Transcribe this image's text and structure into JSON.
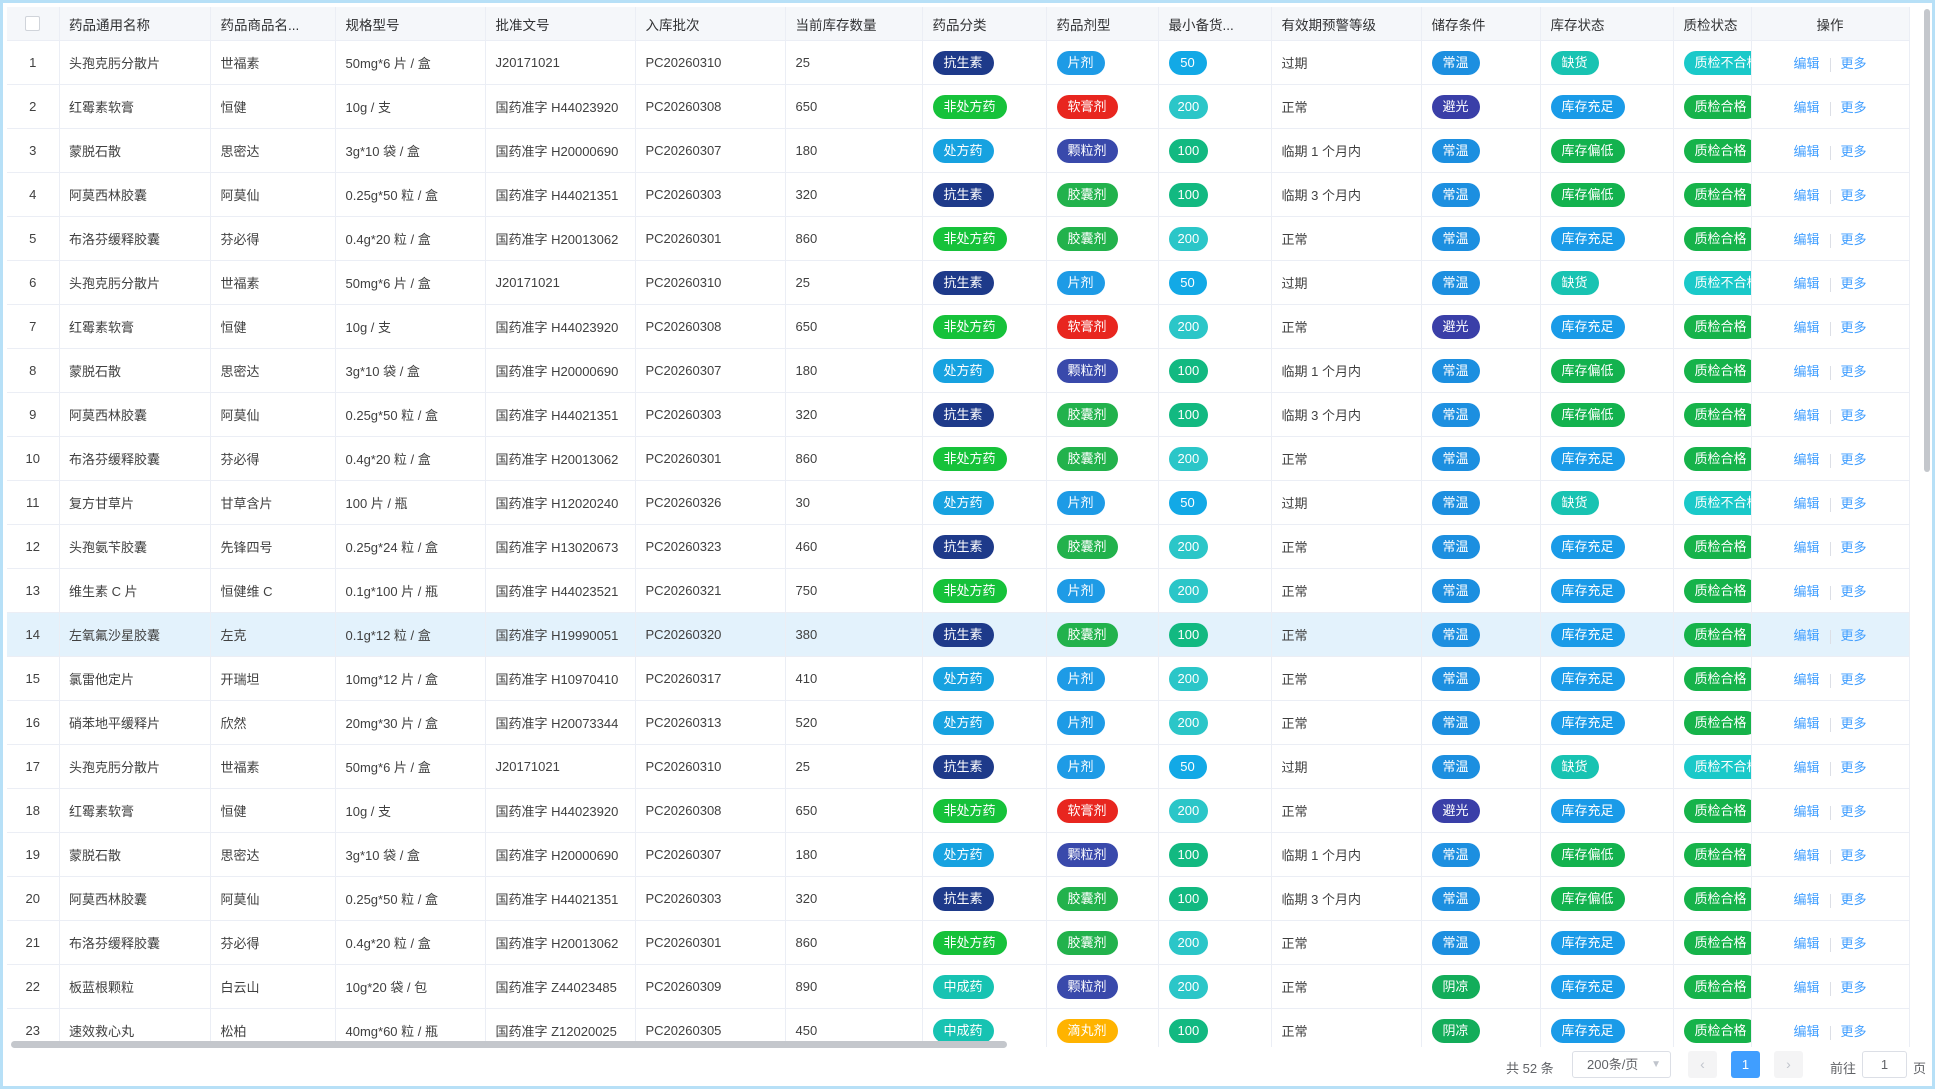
{
  "table": {
    "columns": [
      "",
      "",
      "药品通用名称",
      "药品商品名...",
      "规格型号",
      "批准文号",
      "入库批次",
      "当前库存数量",
      "药品分类",
      "药品剂型",
      "最小备货...",
      "有效期预警等级",
      "储存条件",
      "库存状态",
      "质检状态",
      "操作"
    ],
    "highlight_row": 14,
    "op_labels": {
      "edit": "编辑",
      "more": "更多"
    },
    "colors": {
      "抗生素": "#1e3a8a",
      "非处方药": "#16c23a",
      "处方药": "#17a2e0",
      "中成药": "#17c3b2",
      "片剂": "#1e9be6",
      "软膏剂": "#e8261f",
      "颗粒剂": "#3949ab",
      "胶囊剂": "#22b24c",
      "滴丸剂": "#ffb300",
      "qty_50": "#12a9e6",
      "qty_100": "#12b981",
      "qty_200": "#2bc6c8",
      "常温": "#1c8fe0",
      "避光": "#3a3fa8",
      "阴凉": "#13ad5a",
      "缺货": "#18c3b2",
      "库存充足": "#1a9be8",
      "库存偏低": "#13b24e",
      "质检合格": "#16b34a",
      "质检不合": "#1ac9c9"
    },
    "rows": [
      {
        "no": "1",
        "generic": "头孢克肟分散片",
        "brand": "世福素",
        "spec": "50mg*6 片 / 盒",
        "approval": "J20171021",
        "batch": "PC20260310",
        "qty": "25",
        "category": "抗生素",
        "form": "片剂",
        "min": "50",
        "expiry": "过期",
        "storage": "常温",
        "stock": "缺货",
        "qc": "质检不合格"
      },
      {
        "no": "2",
        "generic": "红霉素软膏",
        "brand": "恒健",
        "spec": "10g / 支",
        "approval": "国药准字 H44023920",
        "batch": "PC20260308",
        "qty": "650",
        "category": "非处方药",
        "form": "软膏剂",
        "min": "200",
        "expiry": "正常",
        "storage": "避光",
        "stock": "库存充足",
        "qc": "质检合格"
      },
      {
        "no": "3",
        "generic": "蒙脱石散",
        "brand": "思密达",
        "spec": "3g*10 袋 / 盒",
        "approval": "国药准字 H20000690",
        "batch": "PC20260307",
        "qty": "180",
        "category": "处方药",
        "form": "颗粒剂",
        "min": "100",
        "expiry": "临期 1 个月内",
        "storage": "常温",
        "stock": "库存偏低",
        "qc": "质检合格"
      },
      {
        "no": "4",
        "generic": "阿莫西林胶囊",
        "brand": "阿莫仙",
        "spec": "0.25g*50 粒 / 盒",
        "approval": "国药准字 H44021351",
        "batch": "PC20260303",
        "qty": "320",
        "category": "抗生素",
        "form": "胶囊剂",
        "min": "100",
        "expiry": "临期 3 个月内",
        "storage": "常温",
        "stock": "库存偏低",
        "qc": "质检合格"
      },
      {
        "no": "5",
        "generic": "布洛芬缓释胶囊",
        "brand": "芬必得",
        "spec": "0.4g*20 粒 / 盒",
        "approval": "国药准字 H20013062",
        "batch": "PC20260301",
        "qty": "860",
        "category": "非处方药",
        "form": "胶囊剂",
        "min": "200",
        "expiry": "正常",
        "storage": "常温",
        "stock": "库存充足",
        "qc": "质检合格"
      },
      {
        "no": "6",
        "generic": "头孢克肟分散片",
        "brand": "世福素",
        "spec": "50mg*6 片 / 盒",
        "approval": "J20171021",
        "batch": "PC20260310",
        "qty": "25",
        "category": "抗生素",
        "form": "片剂",
        "min": "50",
        "expiry": "过期",
        "storage": "常温",
        "stock": "缺货",
        "qc": "质检不合格"
      },
      {
        "no": "7",
        "generic": "红霉素软膏",
        "brand": "恒健",
        "spec": "10g / 支",
        "approval": "国药准字 H44023920",
        "batch": "PC20260308",
        "qty": "650",
        "category": "非处方药",
        "form": "软膏剂",
        "min": "200",
        "expiry": "正常",
        "storage": "避光",
        "stock": "库存充足",
        "qc": "质检合格"
      },
      {
        "no": "8",
        "generic": "蒙脱石散",
        "brand": "思密达",
        "spec": "3g*10 袋 / 盒",
        "approval": "国药准字 H20000690",
        "batch": "PC20260307",
        "qty": "180",
        "category": "处方药",
        "form": "颗粒剂",
        "min": "100",
        "expiry": "临期 1 个月内",
        "storage": "常温",
        "stock": "库存偏低",
        "qc": "质检合格"
      },
      {
        "no": "9",
        "generic": "阿莫西林胶囊",
        "brand": "阿莫仙",
        "spec": "0.25g*50 粒 / 盒",
        "approval": "国药准字 H44021351",
        "batch": "PC20260303",
        "qty": "320",
        "category": "抗生素",
        "form": "胶囊剂",
        "min": "100",
        "expiry": "临期 3 个月内",
        "storage": "常温",
        "stock": "库存偏低",
        "qc": "质检合格"
      },
      {
        "no": "10",
        "generic": "布洛芬缓释胶囊",
        "brand": "芬必得",
        "spec": "0.4g*20 粒 / 盒",
        "approval": "国药准字 H20013062",
        "batch": "PC20260301",
        "qty": "860",
        "category": "非处方药",
        "form": "胶囊剂",
        "min": "200",
        "expiry": "正常",
        "storage": "常温",
        "stock": "库存充足",
        "qc": "质检合格"
      },
      {
        "no": "11",
        "generic": "复方甘草片",
        "brand": "甘草含片",
        "spec": "100 片 / 瓶",
        "approval": "国药准字 H12020240",
        "batch": "PC20260326",
        "qty": "30",
        "category": "处方药",
        "form": "片剂",
        "min": "50",
        "expiry": "过期",
        "storage": "常温",
        "stock": "缺货",
        "qc": "质检不合格"
      },
      {
        "no": "12",
        "generic": "头孢氨苄胶囊",
        "brand": "先锋四号",
        "spec": "0.25g*24 粒 / 盒",
        "approval": "国药准字 H13020673",
        "batch": "PC20260323",
        "qty": "460",
        "category": "抗生素",
        "form": "胶囊剂",
        "min": "200",
        "expiry": "正常",
        "storage": "常温",
        "stock": "库存充足",
        "qc": "质检合格"
      },
      {
        "no": "13",
        "generic": "维生素 C 片",
        "brand": "恒健维 C",
        "spec": "0.1g*100 片 / 瓶",
        "approval": "国药准字 H44023521",
        "batch": "PC20260321",
        "qty": "750",
        "category": "非处方药",
        "form": "片剂",
        "min": "200",
        "expiry": "正常",
        "storage": "常温",
        "stock": "库存充足",
        "qc": "质检合格"
      },
      {
        "no": "14",
        "generic": "左氧氟沙星胶囊",
        "brand": "左克",
        "spec": "0.1g*12 粒 / 盒",
        "approval": "国药准字 H19990051",
        "batch": "PC20260320",
        "qty": "380",
        "category": "抗生素",
        "form": "胶囊剂",
        "min": "100",
        "expiry": "正常",
        "storage": "常温",
        "stock": "库存充足",
        "qc": "质检合格"
      },
      {
        "no": "15",
        "generic": "氯雷他定片",
        "brand": "开瑞坦",
        "spec": "10mg*12 片 / 盒",
        "approval": "国药准字 H10970410",
        "batch": "PC20260317",
        "qty": "410",
        "category": "处方药",
        "form": "片剂",
        "min": "200",
        "expiry": "正常",
        "storage": "常温",
        "stock": "库存充足",
        "qc": "质检合格"
      },
      {
        "no": "16",
        "generic": "硝苯地平缓释片",
        "brand": "欣然",
        "spec": "20mg*30 片 / 盒",
        "approval": "国药准字 H20073344",
        "batch": "PC20260313",
        "qty": "520",
        "category": "处方药",
        "form": "片剂",
        "min": "200",
        "expiry": "正常",
        "storage": "常温",
        "stock": "库存充足",
        "qc": "质检合格"
      },
      {
        "no": "17",
        "generic": "头孢克肟分散片",
        "brand": "世福素",
        "spec": "50mg*6 片 / 盒",
        "approval": "J20171021",
        "batch": "PC20260310",
        "qty": "25",
        "category": "抗生素",
        "form": "片剂",
        "min": "50",
        "expiry": "过期",
        "storage": "常温",
        "stock": "缺货",
        "qc": "质检不合格"
      },
      {
        "no": "18",
        "generic": "红霉素软膏",
        "brand": "恒健",
        "spec": "10g / 支",
        "approval": "国药准字 H44023920",
        "batch": "PC20260308",
        "qty": "650",
        "category": "非处方药",
        "form": "软膏剂",
        "min": "200",
        "expiry": "正常",
        "storage": "避光",
        "stock": "库存充足",
        "qc": "质检合格"
      },
      {
        "no": "19",
        "generic": "蒙脱石散",
        "brand": "思密达",
        "spec": "3g*10 袋 / 盒",
        "approval": "国药准字 H20000690",
        "batch": "PC20260307",
        "qty": "180",
        "category": "处方药",
        "form": "颗粒剂",
        "min": "100",
        "expiry": "临期 1 个月内",
        "storage": "常温",
        "stock": "库存偏低",
        "qc": "质检合格"
      },
      {
        "no": "20",
        "generic": "阿莫西林胶囊",
        "brand": "阿莫仙",
        "spec": "0.25g*50 粒 / 盒",
        "approval": "国药准字 H44021351",
        "batch": "PC20260303",
        "qty": "320",
        "category": "抗生素",
        "form": "胶囊剂",
        "min": "100",
        "expiry": "临期 3 个月内",
        "storage": "常温",
        "stock": "库存偏低",
        "qc": "质检合格"
      },
      {
        "no": "21",
        "generic": "布洛芬缓释胶囊",
        "brand": "芬必得",
        "spec": "0.4g*20 粒 / 盒",
        "approval": "国药准字 H20013062",
        "batch": "PC20260301",
        "qty": "860",
        "category": "非处方药",
        "form": "胶囊剂",
        "min": "200",
        "expiry": "正常",
        "storage": "常温",
        "stock": "库存充足",
        "qc": "质检合格"
      },
      {
        "no": "22",
        "generic": "板蓝根颗粒",
        "brand": "白云山",
        "spec": "10g*20 袋 / 包",
        "approval": "国药准字 Z44023485",
        "batch": "PC20260309",
        "qty": "890",
        "category": "中成药",
        "form": "颗粒剂",
        "min": "200",
        "expiry": "正常",
        "storage": "阴凉",
        "stock": "库存充足",
        "qc": "质检合格"
      },
      {
        "no": "23",
        "generic": "速效救心丸",
        "brand": "松柏",
        "spec": "40mg*60 粒 / 瓶",
        "approval": "国药准字 Z12020025",
        "batch": "PC20260305",
        "qty": "450",
        "category": "中成药",
        "form": "滴丸剂",
        "min": "100",
        "expiry": "正常",
        "storage": "阴凉",
        "stock": "库存充足",
        "qc": "质检合格"
      }
    ]
  },
  "pagination": {
    "total": "共 52 条",
    "page_size": "200条/页",
    "prev": "‹",
    "current_page": "1",
    "next": "›",
    "goto_label": "前往",
    "goto_value": "1",
    "page_unit": "页"
  }
}
